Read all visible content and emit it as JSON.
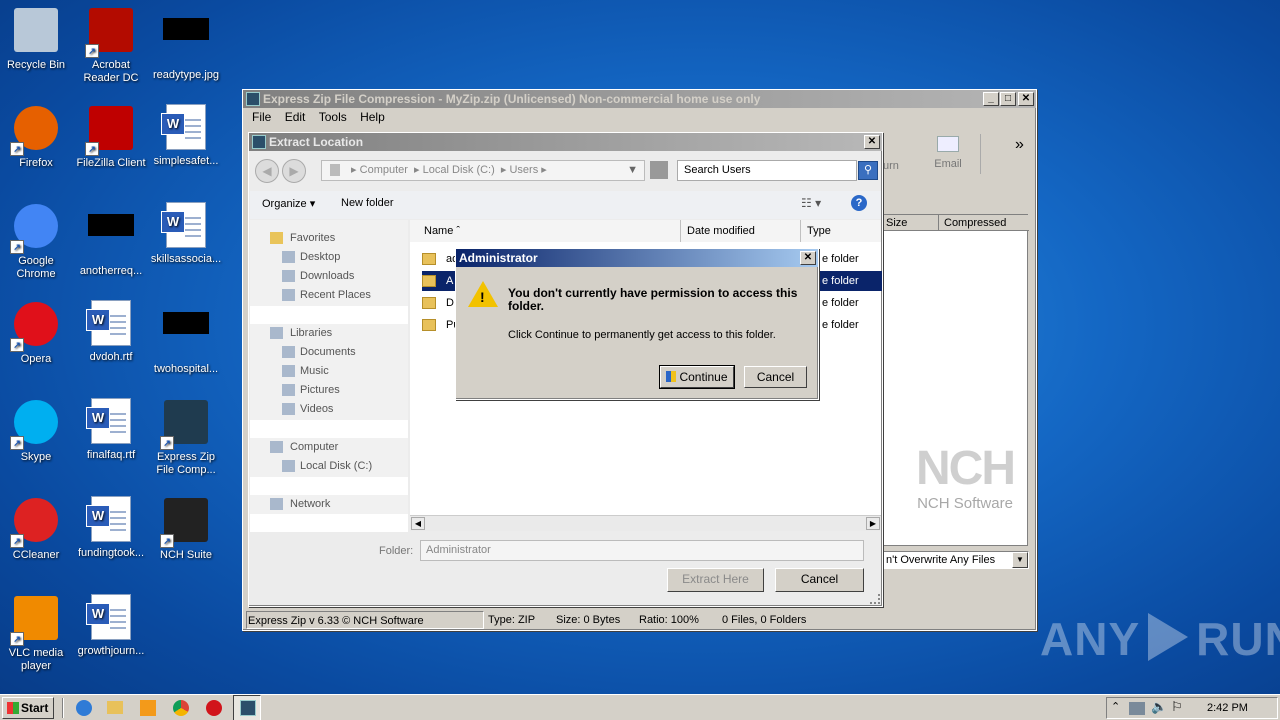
{
  "desktop": {
    "icons": [
      {
        "label": "Recycle Bin",
        "icon": "recycle-bin-icon"
      },
      {
        "label": "Acrobat Reader DC",
        "icon": "acrobat-icon"
      },
      {
        "label": "readytype.jpg",
        "icon": "image-file-icon"
      },
      {
        "label": "Firefox",
        "icon": "firefox-icon"
      },
      {
        "label": "FileZilla Client",
        "icon": "filezilla-icon"
      },
      {
        "label": "simplesafet...",
        "icon": "word-doc-icon"
      },
      {
        "label": "Google Chrome",
        "icon": "chrome-icon"
      },
      {
        "label": "anotherreq...",
        "icon": "image-file-icon"
      },
      {
        "label": "skillsassocia...",
        "icon": "word-doc-icon"
      },
      {
        "label": "Opera",
        "icon": "opera-icon"
      },
      {
        "label": "dvdoh.rtf",
        "icon": "word-doc-icon"
      },
      {
        "label": "twohospital...",
        "icon": "image-file-icon"
      },
      {
        "label": "Skype",
        "icon": "skype-icon"
      },
      {
        "label": "finalfaq.rtf",
        "icon": "word-doc-icon"
      },
      {
        "label": "Express Zip File Comp...",
        "icon": "express-zip-icon"
      },
      {
        "label": "CCleaner",
        "icon": "ccleaner-icon"
      },
      {
        "label": "fundingtook...",
        "icon": "word-doc-icon"
      },
      {
        "label": "NCH Suite",
        "icon": "nch-icon"
      },
      {
        "label": "VLC media player",
        "icon": "vlc-icon"
      },
      {
        "label": "growthjourn...",
        "icon": "word-doc-icon"
      }
    ]
  },
  "zip_window": {
    "title": "Express Zip File Compression - MyZip.zip (Unlicensed) Non-commercial home use only",
    "menu": [
      "File",
      "Edit",
      "Tools",
      "Help"
    ],
    "toolbar_partial": "urn",
    "email_label": "Email",
    "col_size": "Size",
    "col_compressed": "Compressed",
    "overwrite_value": "n't Overwrite Any Files",
    "brand_logo": "NCH",
    "brand_name": "NCH Software",
    "status": {
      "version": "Express Zip v 6.33 © NCH Software",
      "type": "Type: ZIP",
      "size": "Size: 0 Bytes",
      "ratio": "Ratio: 100%",
      "files": "0 Files, 0 Folders"
    }
  },
  "extract_dialog": {
    "title": "Extract Location",
    "breadcrumb": [
      "Computer",
      "Local Disk (C:)",
      "Users"
    ],
    "search_placeholder": "Search Users",
    "organize_label": "Organize",
    "new_folder_label": "New folder",
    "nav": {
      "favorites": "Favorites",
      "desktop": "Desktop",
      "downloads": "Downloads",
      "recent": "Recent Places",
      "libraries": "Libraries",
      "documents": "Documents",
      "music": "Music",
      "pictures": "Pictures",
      "videos": "Videos",
      "computer": "Computer",
      "local_disk": "Local Disk (C:)",
      "network": "Network"
    },
    "columns": {
      "name": "Name",
      "date": "Date modified",
      "type": "Type"
    },
    "rows": [
      {
        "name": "ad",
        "type": "e folder"
      },
      {
        "name": "A",
        "type": "e folder"
      },
      {
        "name": "D",
        "type": "e folder"
      },
      {
        "name": "Pu",
        "type": "e folder"
      }
    ],
    "folder_label": "Folder:",
    "folder_value": "Administrator",
    "extract_button": "Extract Here",
    "cancel_button": "Cancel"
  },
  "admin_dialog": {
    "title": "Administrator",
    "heading": "You don't currently have permission to access this folder.",
    "message": "Click Continue to permanently get access to this folder.",
    "continue_button": "Continue",
    "cancel_button": "Cancel"
  },
  "taskbar": {
    "start_label": "Start",
    "clock": "2:42 PM"
  },
  "watermark": {
    "left": "ANY",
    "right": "RUN"
  }
}
